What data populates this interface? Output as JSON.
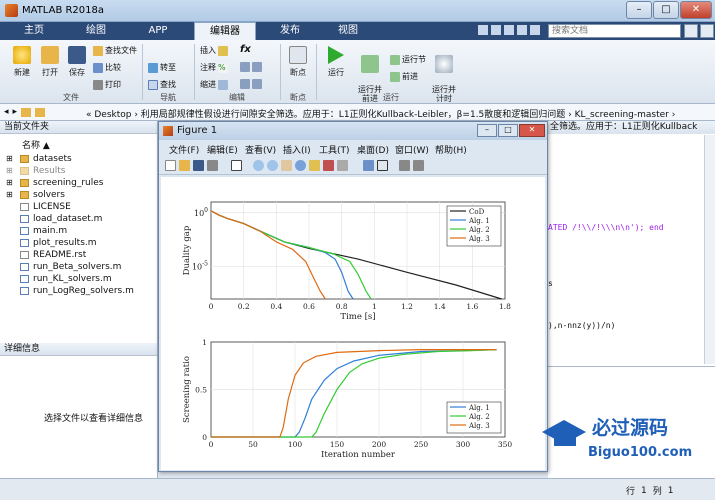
{
  "window": {
    "title": "MATLAB R2018a",
    "min": "–",
    "max": "□",
    "close": "✕"
  },
  "tabs": [
    {
      "label": "主页"
    },
    {
      "label": "绘图"
    },
    {
      "label": "APP"
    },
    {
      "label": "编辑器"
    },
    {
      "label": "发布"
    },
    {
      "label": "视图"
    }
  ],
  "search": {
    "placeholder": "搜索文档"
  },
  "ribbon": {
    "new": "新建",
    "open": "打开",
    "save": "保存",
    "find_files": "查找文件",
    "compare": "比较",
    "print": "打印",
    "goto": "转至",
    "find": "查找",
    "group_file": "文件",
    "group_nav": "导航",
    "insert": "插入",
    "comment": "注释",
    "indent": "缩进",
    "fx": "fx",
    "group_edit": "编辑",
    "breakpoint": "断点",
    "group_bp": "断点",
    "run": "运行",
    "run_advance": "运行并\n前进",
    "run_section": "运行节",
    "advance": "前进",
    "run_time": "运行并\n计时",
    "group_run": "运行"
  },
  "address": {
    "path": "« Desktop  ›  利用局部规律性假设进行间隙安全筛选。应用于：L1正则化Kullback-Leibler，β=1.5散度和逻辑回归问题  ›  KL_screening-master  ›"
  },
  "filepanel": {
    "header": "当前文件夹",
    "col_name": "名称 ▲",
    "files": [
      {
        "name": "datasets",
        "type": "folder"
      },
      {
        "name": "Results",
        "type": "folder",
        "dim": true
      },
      {
        "name": "screening_rules",
        "type": "folder"
      },
      {
        "name": "solvers",
        "type": "folder"
      },
      {
        "name": "LICENSE",
        "type": "txt"
      },
      {
        "name": "load_dataset.m",
        "type": "m"
      },
      {
        "name": "main.m",
        "type": "m"
      },
      {
        "name": "plot_results.m",
        "type": "m"
      },
      {
        "name": "README.rst",
        "type": "txt"
      },
      {
        "name": "run_Beta_solvers.m",
        "type": "m"
      },
      {
        "name": "run_KL_solvers.m",
        "type": "m"
      },
      {
        "name": "run_LogReg_solvers.m",
        "type": "m"
      }
    ],
    "details_header": "详细信息",
    "details_text": "选择文件以查看详细信息"
  },
  "editor": {
    "tab": "全筛选。应用于：L1正则化Kullback",
    "lines": [
      "ATED /!\\\\/!\\\\\\n\\n'); end",
      "s",
      "),n-nnz(y))/n)"
    ]
  },
  "status": {
    "row_label": "行",
    "row": "1",
    "col_label": "列",
    "col": "1"
  },
  "figure": {
    "title": "Figure 1",
    "menu": [
      "文件(F)",
      "编辑(E)",
      "查看(V)",
      "插入(I)",
      "工具(T)",
      "桌面(D)",
      "窗口(W)",
      "帮助(H)"
    ]
  },
  "chart_data": [
    {
      "type": "line",
      "title": "",
      "xlabel": "Time [s]",
      "ylabel": "Duality gap",
      "xlim": [
        0,
        1.8
      ],
      "ylim": [
        1e-08,
        10
      ],
      "yscale": "log",
      "xticks": [
        "0",
        "0.2",
        "0.4",
        "0.6",
        "0.8",
        "1",
        "1.2",
        "1.4",
        "1.6",
        "1.8"
      ],
      "yticks": [
        "10^0",
        "10^-5"
      ],
      "legend": "top-right",
      "grid": true,
      "series": [
        {
          "name": "CoD",
          "color": "#222222",
          "x": [
            0,
            0.05,
            0.1,
            0.2,
            0.3,
            0.45,
            0.6,
            0.9,
            1.2,
            1.5,
            1.78
          ],
          "y": [
            1.5,
            0.6,
            0.3,
            0.1,
            0.02,
            0.002,
            0.0005,
            5e-05,
            3e-06,
            2e-07,
            1e-08
          ]
        },
        {
          "name": "Alg. 1",
          "color": "#2f7fd8",
          "x": [
            0,
            0.05,
            0.1,
            0.2,
            0.3,
            0.45,
            0.6,
            0.7,
            0.76,
            0.8,
            0.84,
            0.87
          ],
          "y": [
            1.5,
            0.6,
            0.3,
            0.1,
            0.02,
            0.002,
            0.0006,
            0.0002,
            5e-05,
            3e-06,
            5e-08,
            1e-08
          ]
        },
        {
          "name": "Alg. 2",
          "color": "#33cc33",
          "x": [
            0,
            0.05,
            0.1,
            0.2,
            0.3,
            0.45,
            0.6,
            0.75,
            0.85,
            0.9,
            0.95,
            0.98
          ],
          "y": [
            1.5,
            0.6,
            0.3,
            0.1,
            0.02,
            0.002,
            0.0006,
            0.00015,
            3e-05,
            2e-06,
            5e-08,
            1e-08
          ]
        },
        {
          "name": "Alg. 3",
          "color": "#e06a10",
          "x": [
            0,
            0.05,
            0.1,
            0.2,
            0.3,
            0.4,
            0.5,
            0.58,
            0.63,
            0.67,
            0.7
          ],
          "y": [
            1.5,
            0.6,
            0.3,
            0.1,
            0.02,
            0.002,
            0.0004,
            3e-05,
            8e-07,
            5e-08,
            1e-08
          ]
        }
      ]
    },
    {
      "type": "line",
      "title": "",
      "xlabel": "Iteration number",
      "ylabel": "Screening ratio",
      "xlim": [
        0,
        350
      ],
      "ylim": [
        0,
        1
      ],
      "xticks": [
        "0",
        "50",
        "100",
        "150",
        "200",
        "250",
        "300",
        "350"
      ],
      "yticks": [
        "0",
        "0.5",
        "1"
      ],
      "legend": "bottom-right",
      "grid": true,
      "series": [
        {
          "name": "Alg. 1",
          "color": "#2f7fd8",
          "x": [
            0,
            100,
            105,
            112,
            120,
            135,
            150,
            170,
            200,
            250,
            300,
            340
          ],
          "y": [
            0,
            0,
            0.05,
            0.2,
            0.4,
            0.6,
            0.72,
            0.8,
            0.86,
            0.9,
            0.91,
            0.92
          ]
        },
        {
          "name": "Alg. 2",
          "color": "#33cc33",
          "x": [
            0,
            120,
            125,
            135,
            150,
            165,
            180,
            200,
            230,
            270,
            310,
            340
          ],
          "y": [
            0,
            0,
            0.05,
            0.25,
            0.5,
            0.68,
            0.77,
            0.83,
            0.87,
            0.9,
            0.91,
            0.92
          ]
        },
        {
          "name": "Alg. 3",
          "color": "#e06a10",
          "x": [
            0,
            82,
            86,
            92,
            100,
            110,
            125,
            150,
            200,
            250,
            300,
            340
          ],
          "y": [
            0,
            0,
            0.1,
            0.4,
            0.65,
            0.78,
            0.85,
            0.89,
            0.91,
            0.92,
            0.92,
            0.92
          ]
        }
      ]
    }
  ],
  "watermark": {
    "text": "必过源码",
    "url": "Biguo100.com"
  }
}
